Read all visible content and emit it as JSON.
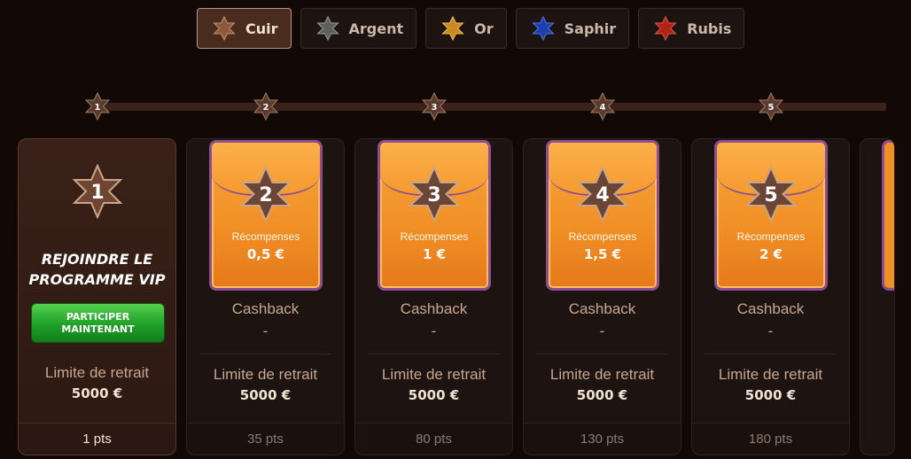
{
  "tabs": [
    {
      "label": "Cuir",
      "icon": "star-leather-icon",
      "color": "#8a5a40",
      "active": true
    },
    {
      "label": "Argent",
      "icon": "star-silver-icon",
      "color": "#5e5e5e",
      "active": false
    },
    {
      "label": "Or",
      "icon": "star-gold-icon",
      "color": "#c98a1f",
      "active": false
    },
    {
      "label": "Saphir",
      "icon": "star-sapphire-icon",
      "color": "#1c3fb0",
      "active": false
    },
    {
      "label": "Rubis",
      "icon": "star-ruby-icon",
      "color": "#b02418",
      "active": false
    }
  ],
  "track": [
    "1",
    "2",
    "3",
    "4",
    "5"
  ],
  "join_card": {
    "level": "1",
    "title_line1": "Rejoindre le",
    "title_line2": "programme VIP",
    "button_line1": "PARTICIPER",
    "button_line2": "MAINTENANT",
    "withdraw_label": "Limite de retrait",
    "withdraw_value": "5000 €",
    "points": "1 pts"
  },
  "levels": [
    {
      "level": "2",
      "reward_label": "Récompenses",
      "reward": "0,5 €",
      "cashback_label": "Cashback",
      "cashback": "-",
      "withdraw_label": "Limite de retrait",
      "withdraw_value": "5000 €",
      "points": "35 pts"
    },
    {
      "level": "3",
      "reward_label": "Récompenses",
      "reward": "1 €",
      "cashback_label": "Cashback",
      "cashback": "-",
      "withdraw_label": "Limite de retrait",
      "withdraw_value": "5000 €",
      "points": "80 pts"
    },
    {
      "level": "4",
      "reward_label": "Récompenses",
      "reward": "1,5 €",
      "cashback_label": "Cashback",
      "cashback": "-",
      "withdraw_label": "Limite de retrait",
      "withdraw_value": "5000 €",
      "points": "130 pts"
    },
    {
      "level": "5",
      "reward_label": "Récompenses",
      "reward": "2 €",
      "cashback_label": "Cashback",
      "cashback": "-",
      "withdraw_label": "Limite de retrait",
      "withdraw_value": "5000 €",
      "points": "180 pts"
    }
  ],
  "colors": {
    "accent": "#f08f25",
    "button": "#1f9f28",
    "leather": "#6e4632"
  }
}
